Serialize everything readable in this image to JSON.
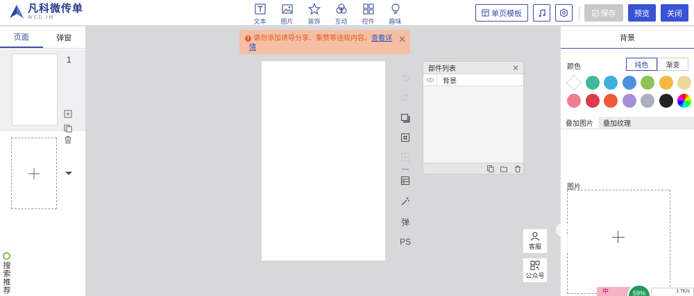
{
  "app": {
    "logo_title": "凡科微传单",
    "logo_sub": "WCD.IM"
  },
  "toolbar": {
    "tools": [
      {
        "label": "文本",
        "icon": "text-icon"
      },
      {
        "label": "图片",
        "icon": "image-icon"
      },
      {
        "label": "装饰",
        "icon": "star-icon"
      },
      {
        "label": "互动",
        "icon": "interaction-icon"
      },
      {
        "label": "控件",
        "icon": "widget-icon"
      },
      {
        "label": "趣味",
        "icon": "bulb-icon"
      }
    ],
    "template_label": "单页模板",
    "save_label": "保存",
    "preview_label": "预览",
    "close_label": "关闭"
  },
  "left_panel": {
    "tab_pages": "页面",
    "tab_popup": "弹窗",
    "page_number": "1",
    "search_recommend": "搜索推荐"
  },
  "notice": {
    "text": "请勿添加诱导分享、集赞等违规内容。",
    "link": "查看详情"
  },
  "vtools": {
    "popup_label": "弹",
    "ps_label": "PS"
  },
  "component_list": {
    "title": "部件列表",
    "items": [
      "背景"
    ]
  },
  "right_panel": {
    "title": "背景",
    "color_label": "颜色",
    "tab_solid": "纯色",
    "tab_gradient": "渐变",
    "swatches": [
      "#ffffff",
      "#3fb99a",
      "#3db0dd",
      "#4f8fdf",
      "#8fc355",
      "#f5b83f",
      "#efd79a",
      "#f07d8f",
      "#dc3b4a",
      "#ef5a3d",
      "#a78fd8",
      "#a9b0bc",
      "#222222",
      "rainbow"
    ],
    "subtab_image": "叠加图片",
    "subtab_texture": "叠加纹理",
    "image_label": "图片"
  },
  "floating": {
    "customer_label": "客服",
    "official_label": "公众号"
  },
  "speed": {
    "label": "中",
    "percent": "59%",
    "rate": "1.7K/s"
  },
  "colors": {
    "brand": "#3a4ba8",
    "primary": "#3a52d6",
    "notice_bg": "#f5bfa3",
    "notice_text": "#e25a28"
  }
}
